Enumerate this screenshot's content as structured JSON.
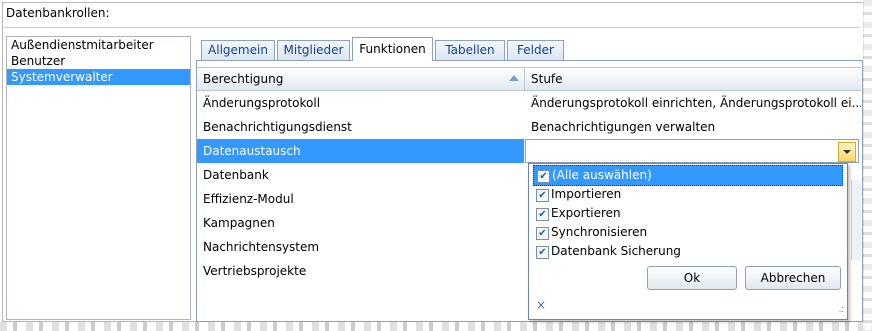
{
  "title": "Datenbankrollen:",
  "roles": [
    {
      "label": "Außendienstmitarbeiter",
      "selected": false
    },
    {
      "label": "Benutzer",
      "selected": false
    },
    {
      "label": "Systemverwalter",
      "selected": true
    }
  ],
  "tabs": [
    {
      "label": "Allgemein",
      "active": false
    },
    {
      "label": "Mitglieder",
      "active": false
    },
    {
      "label": "Funktionen",
      "active": true
    },
    {
      "label": "Tabellen",
      "active": false
    },
    {
      "label": "Felder",
      "active": false
    }
  ],
  "grid": {
    "headers": {
      "berechtigung": "Berechtigung",
      "stufe": "Stufe"
    },
    "rows": [
      {
        "berechtigung": "Änderungsprotokoll",
        "stufe": "Änderungsprotokoll einrichten, Änderungsprotokoll ei..."
      },
      {
        "berechtigung": "Benachrichtigungsdienst",
        "stufe": "Benachrichtigungen verwalten"
      },
      {
        "berechtigung": "Datenaustausch",
        "stufe": ""
      },
      {
        "berechtigung": "Datenbank",
        "stufe": ""
      },
      {
        "berechtigung": "Effizienz-Modul",
        "stufe": ""
      },
      {
        "berechtigung": "Kampagnen",
        "stufe": ""
      },
      {
        "berechtigung": "Nachrichtensystem",
        "stufe": ""
      },
      {
        "berechtigung": "Vertriebsprojekte",
        "stufe": ""
      }
    ]
  },
  "dropdown": {
    "options": [
      {
        "label": "(Alle auswählen)",
        "checked": true
      },
      {
        "label": "Importieren",
        "checked": true
      },
      {
        "label": "Exportieren",
        "checked": true
      },
      {
        "label": "Synchronisieren",
        "checked": true
      },
      {
        "label": "Datenbank Sicherung",
        "checked": true
      }
    ],
    "ok_label": "Ok",
    "cancel_label": "Abbrechen",
    "close_icon": "×",
    "grip_icon": ".:"
  },
  "check_glyph": "✔"
}
